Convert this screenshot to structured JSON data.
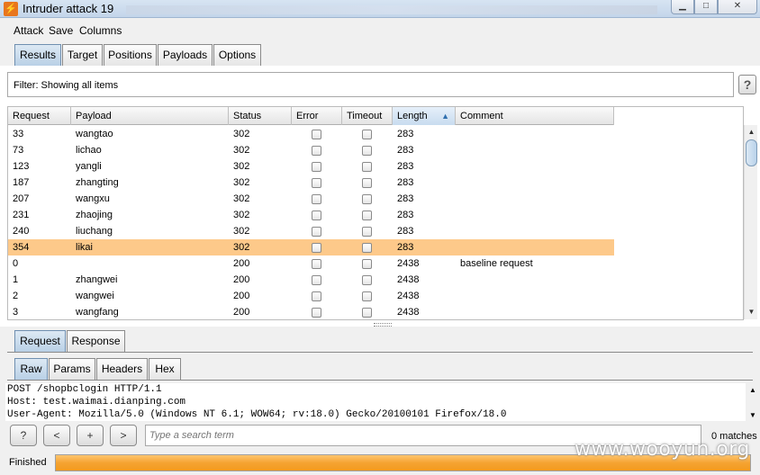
{
  "window": {
    "title": "Intruder attack 19",
    "minimize": "▁",
    "maximize": "□",
    "close": "✕"
  },
  "menu": [
    "Attack",
    "Save",
    "Columns"
  ],
  "main_tabs": [
    {
      "label": "Results",
      "active": true
    },
    {
      "label": "Target",
      "active": false
    },
    {
      "label": "Positions",
      "active": false
    },
    {
      "label": "Payloads",
      "active": false
    },
    {
      "label": "Options",
      "active": false
    }
  ],
  "filter": {
    "text": "Filter:  Showing all items",
    "help": "?"
  },
  "table": {
    "columns": [
      "Request",
      "Payload",
      "Status",
      "Error",
      "Timeout",
      "Length",
      "Comment"
    ],
    "sorted_column": "Length",
    "rows": [
      {
        "request": "33",
        "payload": "wangtao",
        "status": "302",
        "error": false,
        "timeout": false,
        "length": "283",
        "comment": "",
        "selected": false
      },
      {
        "request": "73",
        "payload": "lichao",
        "status": "302",
        "error": false,
        "timeout": false,
        "length": "283",
        "comment": "",
        "selected": false
      },
      {
        "request": "123",
        "payload": "yangli",
        "status": "302",
        "error": false,
        "timeout": false,
        "length": "283",
        "comment": "",
        "selected": false
      },
      {
        "request": "187",
        "payload": "zhangting",
        "status": "302",
        "error": false,
        "timeout": false,
        "length": "283",
        "comment": "",
        "selected": false
      },
      {
        "request": "207",
        "payload": "wangxu",
        "status": "302",
        "error": false,
        "timeout": false,
        "length": "283",
        "comment": "",
        "selected": false
      },
      {
        "request": "231",
        "payload": "zhaojing",
        "status": "302",
        "error": false,
        "timeout": false,
        "length": "283",
        "comment": "",
        "selected": false
      },
      {
        "request": "240",
        "payload": "liuchang",
        "status": "302",
        "error": false,
        "timeout": false,
        "length": "283",
        "comment": "",
        "selected": false
      },
      {
        "request": "354",
        "payload": "likai",
        "status": "302",
        "error": false,
        "timeout": false,
        "length": "283",
        "comment": "",
        "selected": true
      },
      {
        "request": "0",
        "payload": "",
        "status": "200",
        "error": false,
        "timeout": false,
        "length": "2438",
        "comment": "baseline request",
        "selected": false
      },
      {
        "request": "1",
        "payload": "zhangwei",
        "status": "200",
        "error": false,
        "timeout": false,
        "length": "2438",
        "comment": "",
        "selected": false
      },
      {
        "request": "2",
        "payload": "wangwei",
        "status": "200",
        "error": false,
        "timeout": false,
        "length": "2438",
        "comment": "",
        "selected": false
      },
      {
        "request": "3",
        "payload": "wangfang",
        "status": "200",
        "error": false,
        "timeout": false,
        "length": "2438",
        "comment": "",
        "selected": false
      }
    ]
  },
  "reqresp_tabs": [
    {
      "label": "Request",
      "active": true
    },
    {
      "label": "Response",
      "active": false
    }
  ],
  "view_tabs": [
    {
      "label": "Raw",
      "active": true
    },
    {
      "label": "Params",
      "active": false
    },
    {
      "label": "Headers",
      "active": false
    },
    {
      "label": "Hex",
      "active": false
    }
  ],
  "message": [
    "POST /shopbclogin HTTP/1.1",
    "Host: test.waimai.dianping.com",
    "User-Agent: Mozilla/5.0 (Windows NT 6.1; WOW64; rv:18.0) Gecko/20100101 Firefox/18.0"
  ],
  "search": {
    "help": "?",
    "prev": "<",
    "add": "+",
    "next": ">",
    "placeholder": "Type a search term",
    "matches": "0 matches"
  },
  "status": {
    "label": "Finished",
    "progress": 1.0
  },
  "watermark": "www.wooyun.org",
  "colors": {
    "selected_row": "#fdc98a",
    "progress": "#f5a332",
    "active_tab": "#b9d0e6"
  }
}
